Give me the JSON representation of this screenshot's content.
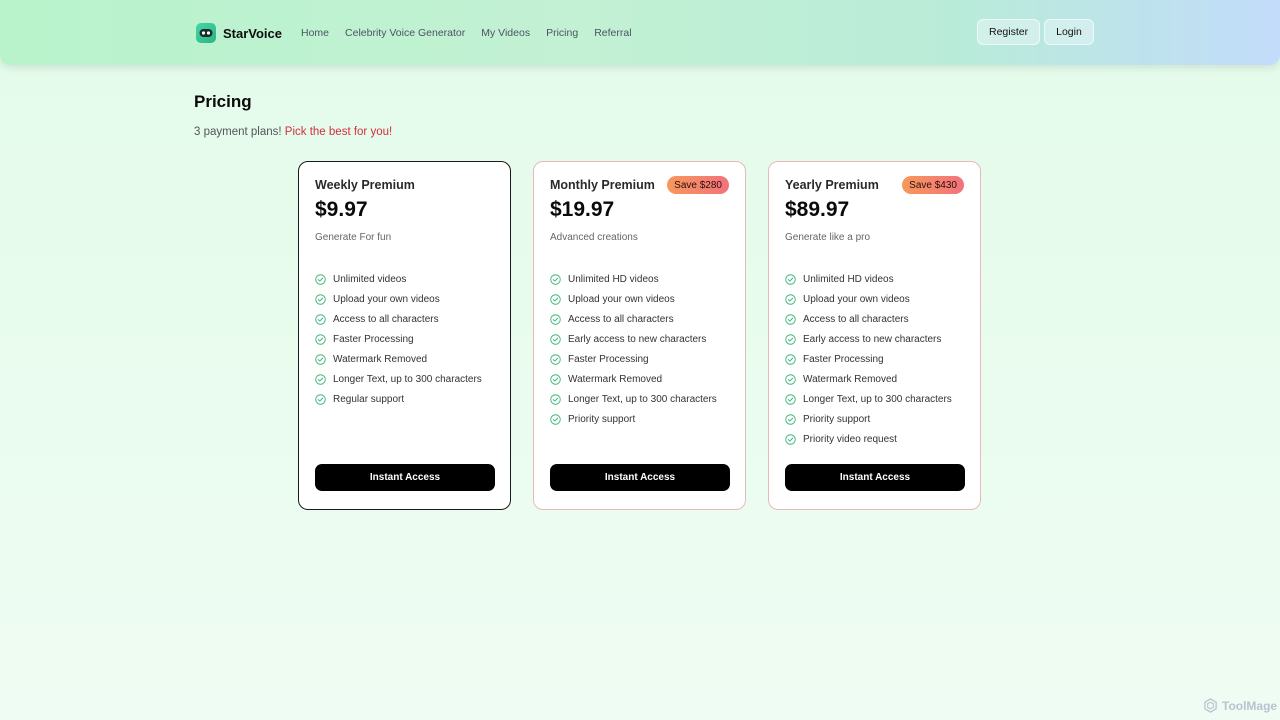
{
  "header": {
    "brand": "StarVoice",
    "nav": [
      "Home",
      "Celebrity Voice Generator",
      "My Videos",
      "Pricing",
      "Referral"
    ],
    "register_label": "Register",
    "login_label": "Login"
  },
  "main": {
    "title": "Pricing",
    "subtitle_prefix": "3 payment plans!",
    "subtitle_accent": "Pick the best for you!"
  },
  "plans": [
    {
      "name": "Weekly Premium",
      "price": "$9.97",
      "tagline": "Generate For fun",
      "badge": "",
      "features": [
        "Unlimited videos",
        "Upload your own videos",
        "Access to all characters",
        "Faster Processing",
        "Watermark Removed",
        "Longer Text, up to 300 characters",
        "Regular support"
      ],
      "cta": "Instant Access"
    },
    {
      "name": "Monthly Premium",
      "price": "$19.97",
      "tagline": "Advanced creations",
      "badge": "Save $280",
      "features": [
        "Unlimited HD videos",
        "Upload your own videos",
        "Access to all characters",
        "Early access to new characters",
        "Faster Processing",
        "Watermark Removed",
        "Longer Text, up to 300 characters",
        "Priority support"
      ],
      "cta": "Instant Access"
    },
    {
      "name": "Yearly Premium",
      "price": "$89.97",
      "tagline": "Generate like a pro",
      "badge": "Save $430",
      "features": [
        "Unlimited HD videos",
        "Upload your own videos",
        "Access to all characters",
        "Early access to new characters",
        "Faster Processing",
        "Watermark Removed",
        "Longer Text, up to 300 characters",
        "Priority support",
        "Priority video request"
      ],
      "cta": "Instant Access"
    }
  ],
  "watermark": "ToolMage",
  "colors": {
    "accent_text": "#d32f3d",
    "check": "#3fb67b",
    "cta_bg": "#000000"
  }
}
